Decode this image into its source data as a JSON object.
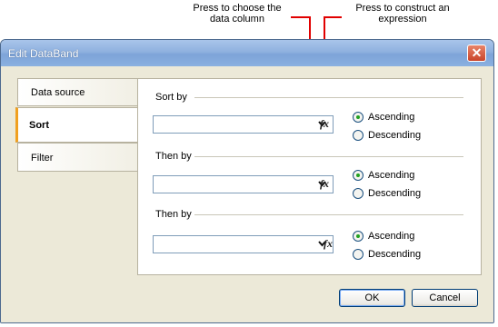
{
  "callouts": {
    "column": [
      "Press to choose the",
      "data column"
    ],
    "expression": [
      "Press to construct an",
      "expression"
    ]
  },
  "window": {
    "title": "Edit DataBand",
    "close_glyph": "✕"
  },
  "tabs": [
    {
      "label": "Data source",
      "active": false
    },
    {
      "label": "Sort",
      "active": true
    },
    {
      "label": "Filter",
      "active": false
    }
  ],
  "groups": [
    {
      "label": "Sort by",
      "combo_value": "",
      "fx_label": "fx",
      "options": [
        "Ascending",
        "Descending"
      ],
      "selected": "Ascending"
    },
    {
      "label": "Then by",
      "combo_value": "",
      "fx_label": "fx",
      "options": [
        "Ascending",
        "Descending"
      ],
      "selected": "Ascending"
    },
    {
      "label": "Then by",
      "combo_value": "",
      "fx_label": "fx",
      "options": [
        "Ascending",
        "Descending"
      ],
      "selected": "Ascending"
    }
  ],
  "buttons": {
    "ok": "OK",
    "cancel": "Cancel"
  },
  "colors": {
    "callout": "#e10000",
    "title_bar": "#8fb1df",
    "tab_accent": "#f0a020"
  },
  "icons": {
    "close": "close-icon",
    "dropdown": "chevron-down-icon",
    "expression": "function-icon"
  }
}
